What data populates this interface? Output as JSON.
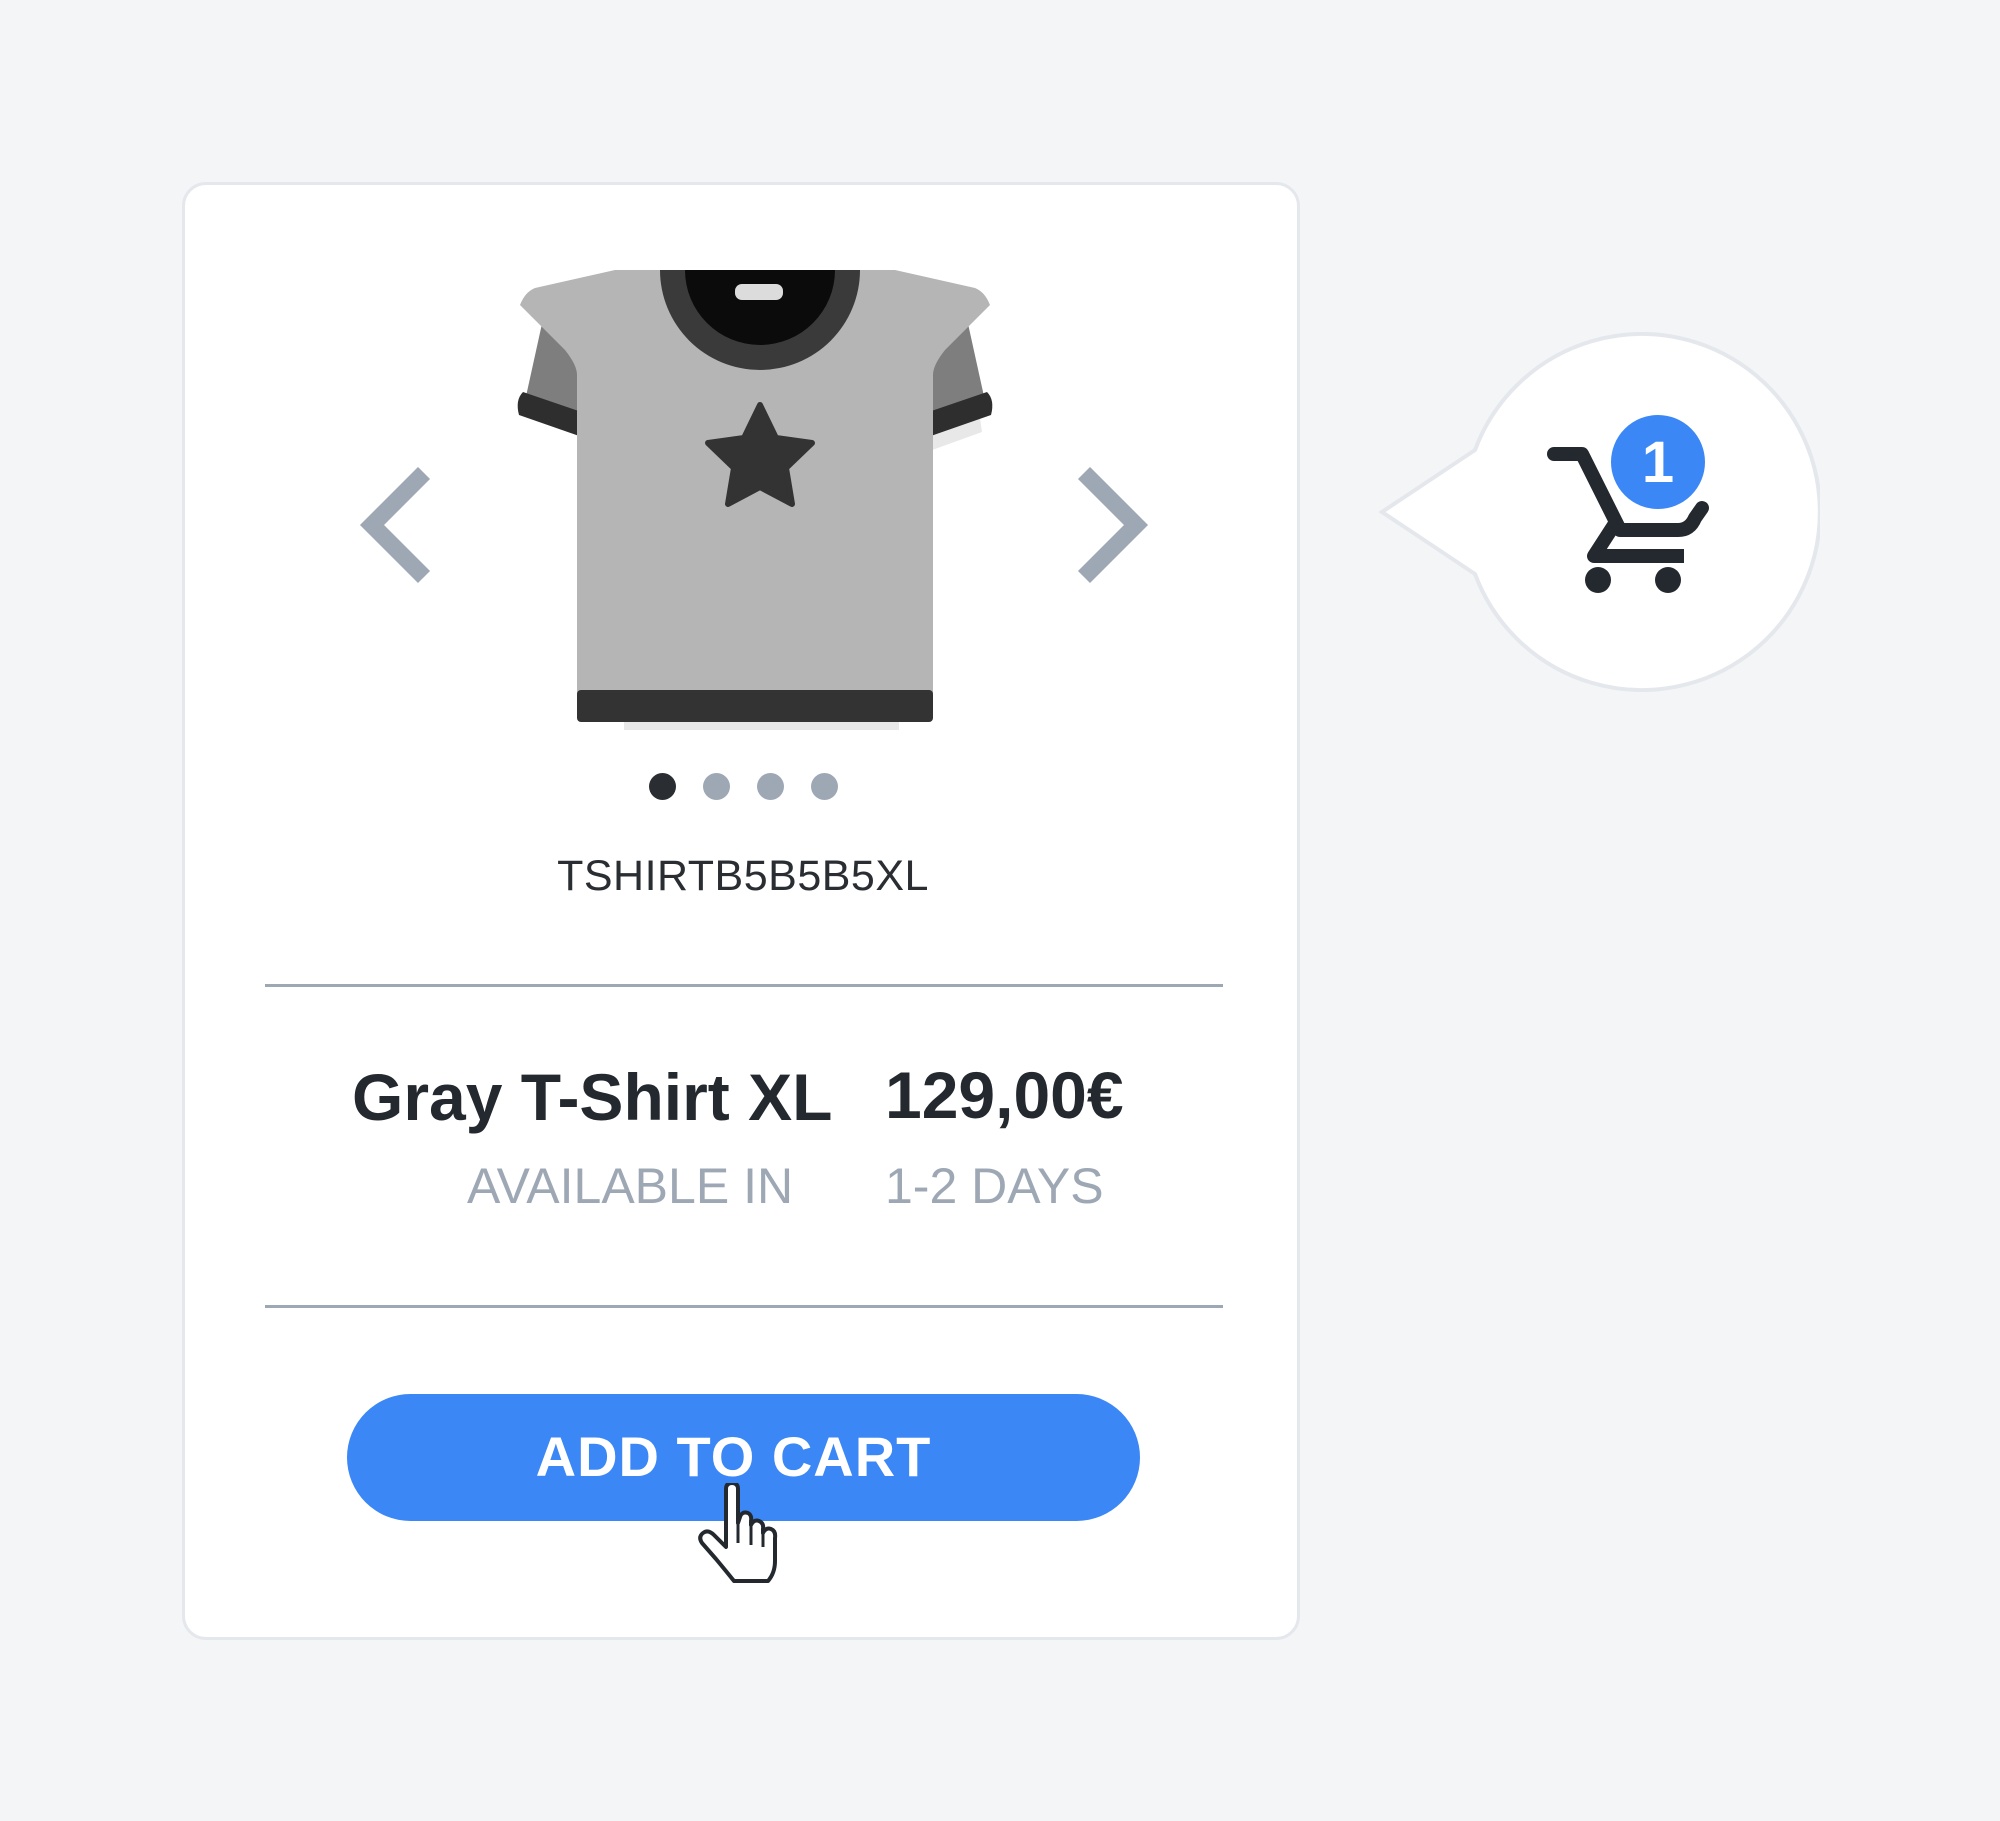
{
  "product": {
    "sku": "TSHIRTB5B5B5XL",
    "name": "Gray T-Shirt XL",
    "price": "129,00€",
    "availability_label": "AVAILABLE IN",
    "availability_value": "1-2 DAYS",
    "image_icon": "t-shirt-icon",
    "image_color": "#b5b5b5"
  },
  "carousel": {
    "prev_icon": "chevron-left-icon",
    "next_icon": "chevron-right-icon",
    "dots_count": 4,
    "active_dot": 1
  },
  "actions": {
    "add_to_cart_label": "ADD TO CART"
  },
  "cart": {
    "icon": "shopping-cart-icon",
    "badge_count": "1"
  },
  "colors": {
    "accent": "#3b87f6",
    "text_dark": "#24292f",
    "text_muted": "#9ea8b5",
    "background": "#f4f5f7",
    "card": "#ffffff"
  }
}
